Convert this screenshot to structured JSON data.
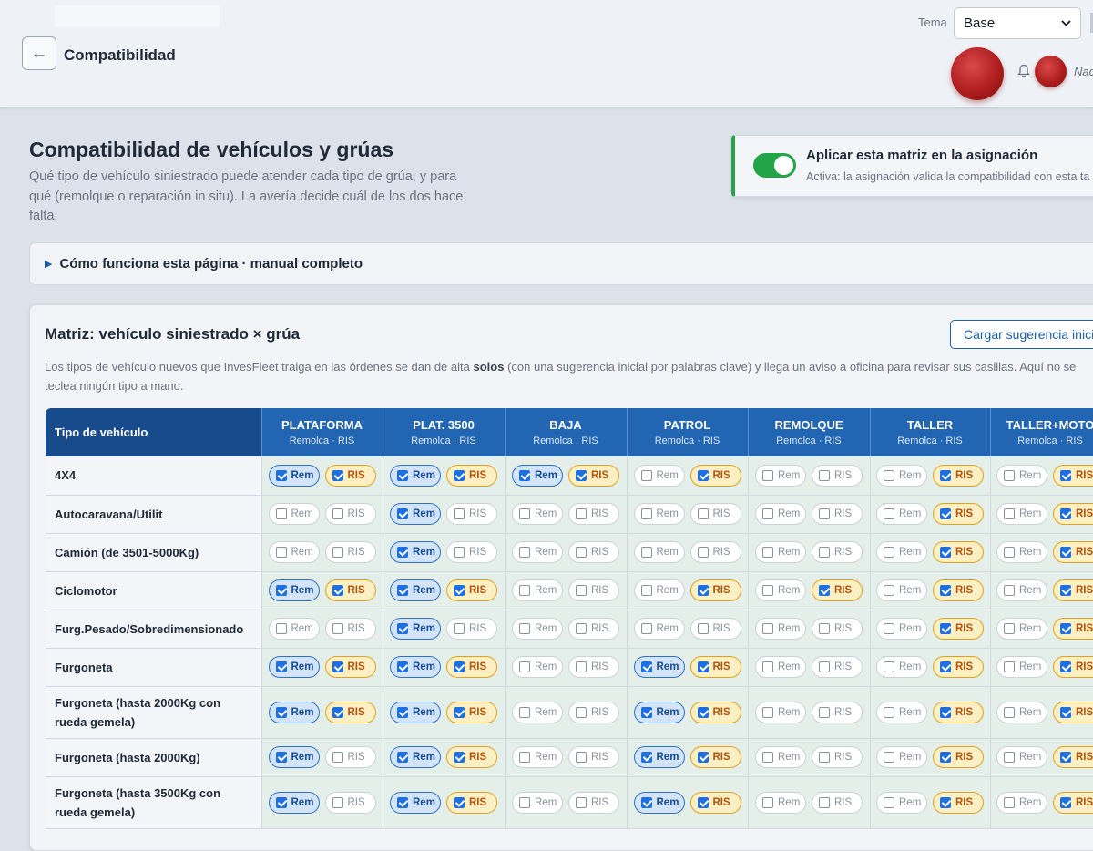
{
  "header": {
    "back_glyph": "←",
    "page_title": "Compatibilidad",
    "theme_label": "Tema",
    "theme_value": "Base",
    "user_name": "Nac"
  },
  "intro": {
    "title": "Compatibilidad de vehículos y grúas",
    "description": "Qué tipo de vehículo siniestrado puede atender cada tipo de grúa, y para qué (remolque o reparación in situ). La avería decide cuál de los dos hace falta.",
    "apply_title": "Aplicar esta matriz en la asignación",
    "apply_subtitle": "Activa: la asignación valida la compatibilidad con esta ta",
    "apply_enabled": true,
    "manual_label": "Cómo funciona esta página · manual completo"
  },
  "matrix": {
    "title": "Matriz: vehículo siniestrado × grúa",
    "suggest_button": "Cargar sugerencia inicia",
    "desc_part1": "Los tipos de vehículo nuevos que InvesFleet traiga en las órdenes se dan de alta ",
    "desc_bold": "solos",
    "desc_part2": " (con una sugerencia inicial por palabras clave) y llega un aviso a oficina para revisar sus casillas. Aquí no se teclea ningún tipo a mano.",
    "first_col_header": "Tipo de vehículo",
    "rem_label": "Rem",
    "ris_label": "RIS",
    "columns": [
      {
        "name": "PLATAFORMA",
        "sub": "Remolca · RIS"
      },
      {
        "name": "PLAT. 3500",
        "sub": "Remolca · RIS"
      },
      {
        "name": "BAJA",
        "sub": "Remolca · RIS"
      },
      {
        "name": "PATROL",
        "sub": "Remolca · RIS"
      },
      {
        "name": "REMOLQUE",
        "sub": "Remolca · RIS"
      },
      {
        "name": "TALLER",
        "sub": "Remolca · RIS"
      },
      {
        "name": "TALLER+MOTO",
        "sub": "Remolca · RIS"
      }
    ],
    "rows": [
      {
        "vehicle": "4X4",
        "cells": [
          [
            true,
            true
          ],
          [
            true,
            true
          ],
          [
            true,
            true
          ],
          [
            false,
            true
          ],
          [
            false,
            false
          ],
          [
            false,
            true
          ],
          [
            false,
            true
          ]
        ]
      },
      {
        "vehicle": "Autocaravana/Utilit",
        "cells": [
          [
            false,
            false
          ],
          [
            true,
            false
          ],
          [
            false,
            false
          ],
          [
            false,
            false
          ],
          [
            false,
            false
          ],
          [
            false,
            true
          ],
          [
            false,
            true
          ]
        ]
      },
      {
        "vehicle": "Camión (de 3501-5000Kg)",
        "cells": [
          [
            false,
            false
          ],
          [
            true,
            false
          ],
          [
            false,
            false
          ],
          [
            false,
            false
          ],
          [
            false,
            false
          ],
          [
            false,
            true
          ],
          [
            false,
            true
          ]
        ]
      },
      {
        "vehicle": "Ciclomotor",
        "cells": [
          [
            true,
            true
          ],
          [
            true,
            true
          ],
          [
            false,
            false
          ],
          [
            false,
            true
          ],
          [
            false,
            true
          ],
          [
            false,
            true
          ],
          [
            false,
            true
          ]
        ]
      },
      {
        "vehicle": "Furg.Pesado/Sobredimensionado",
        "cells": [
          [
            false,
            false
          ],
          [
            true,
            false
          ],
          [
            false,
            false
          ],
          [
            false,
            false
          ],
          [
            false,
            false
          ],
          [
            false,
            true
          ],
          [
            false,
            true
          ]
        ]
      },
      {
        "vehicle": "Furgoneta",
        "cells": [
          [
            true,
            true
          ],
          [
            true,
            true
          ],
          [
            false,
            false
          ],
          [
            true,
            true
          ],
          [
            false,
            false
          ],
          [
            false,
            true
          ],
          [
            false,
            true
          ]
        ]
      },
      {
        "vehicle": "Furgoneta (hasta 2000Kg con rueda gemela)",
        "cells": [
          [
            true,
            true
          ],
          [
            true,
            true
          ],
          [
            false,
            false
          ],
          [
            true,
            true
          ],
          [
            false,
            false
          ],
          [
            false,
            true
          ],
          [
            false,
            true
          ]
        ]
      },
      {
        "vehicle": "Furgoneta (hasta 2000Kg)",
        "cells": [
          [
            true,
            false
          ],
          [
            true,
            true
          ],
          [
            false,
            false
          ],
          [
            true,
            true
          ],
          [
            false,
            false
          ],
          [
            false,
            true
          ],
          [
            false,
            true
          ]
        ]
      },
      {
        "vehicle": "Furgoneta (hasta 3500Kg con rueda gemela)",
        "cells": [
          [
            true,
            false
          ],
          [
            true,
            true
          ],
          [
            false,
            false
          ],
          [
            true,
            true
          ],
          [
            false,
            false
          ],
          [
            false,
            true
          ],
          [
            false,
            true
          ]
        ]
      }
    ]
  },
  "colors": {
    "header_blue": "#2165b3",
    "header_dark_blue": "#174b8c",
    "toggle_green": "#22a447",
    "rem_checked": "#d3e4f9",
    "ris_checked": "#fdefc4"
  },
  "icons": {
    "back": "arrow-left-icon",
    "bell": "bell-icon",
    "expand": "triangle-right-icon",
    "select": "chevron-down-icon"
  }
}
